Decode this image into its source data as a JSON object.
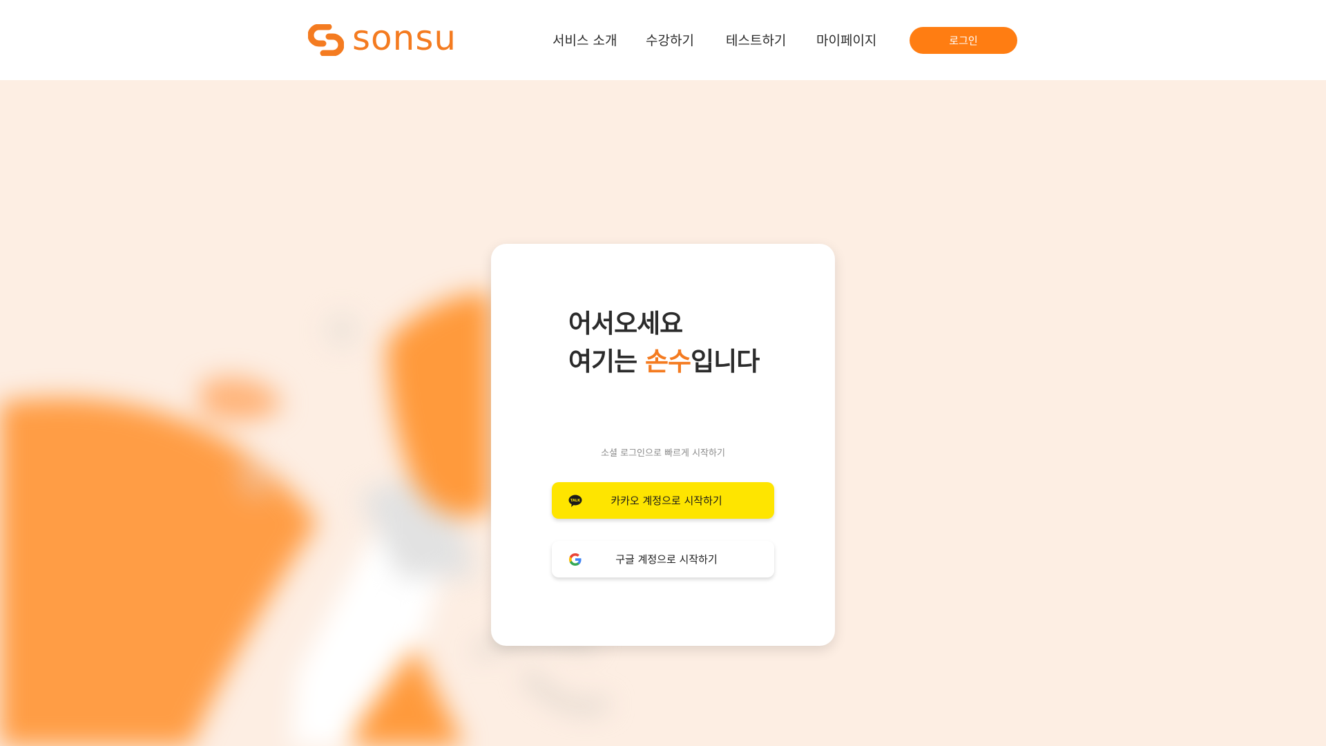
{
  "brand": {
    "name": "sonsu",
    "color": "#f47b20",
    "logo_icon": "link-s-icon"
  },
  "nav": {
    "items": [
      {
        "label": "서비스 소개"
      },
      {
        "label": "수강하기"
      },
      {
        "label": "테스트하기"
      },
      {
        "label": "마이페이지"
      }
    ],
    "login_label": "로그인",
    "login_color": "#ff7d12"
  },
  "card": {
    "title_line1": "어서오세요",
    "title_line2_pre": "여기는 ",
    "title_line2_accent": "손수",
    "title_line2_post": "입니다",
    "social_hint": "소셜 로그인으로 빠르게 시작하기",
    "kakao_label": "카카오 계정으로 시작하기",
    "kakao_icon": "kakao-talk-icon",
    "kakao_color": "#fee500",
    "google_label": "구글 계정으로 시작하기",
    "google_icon": "google-icon"
  }
}
